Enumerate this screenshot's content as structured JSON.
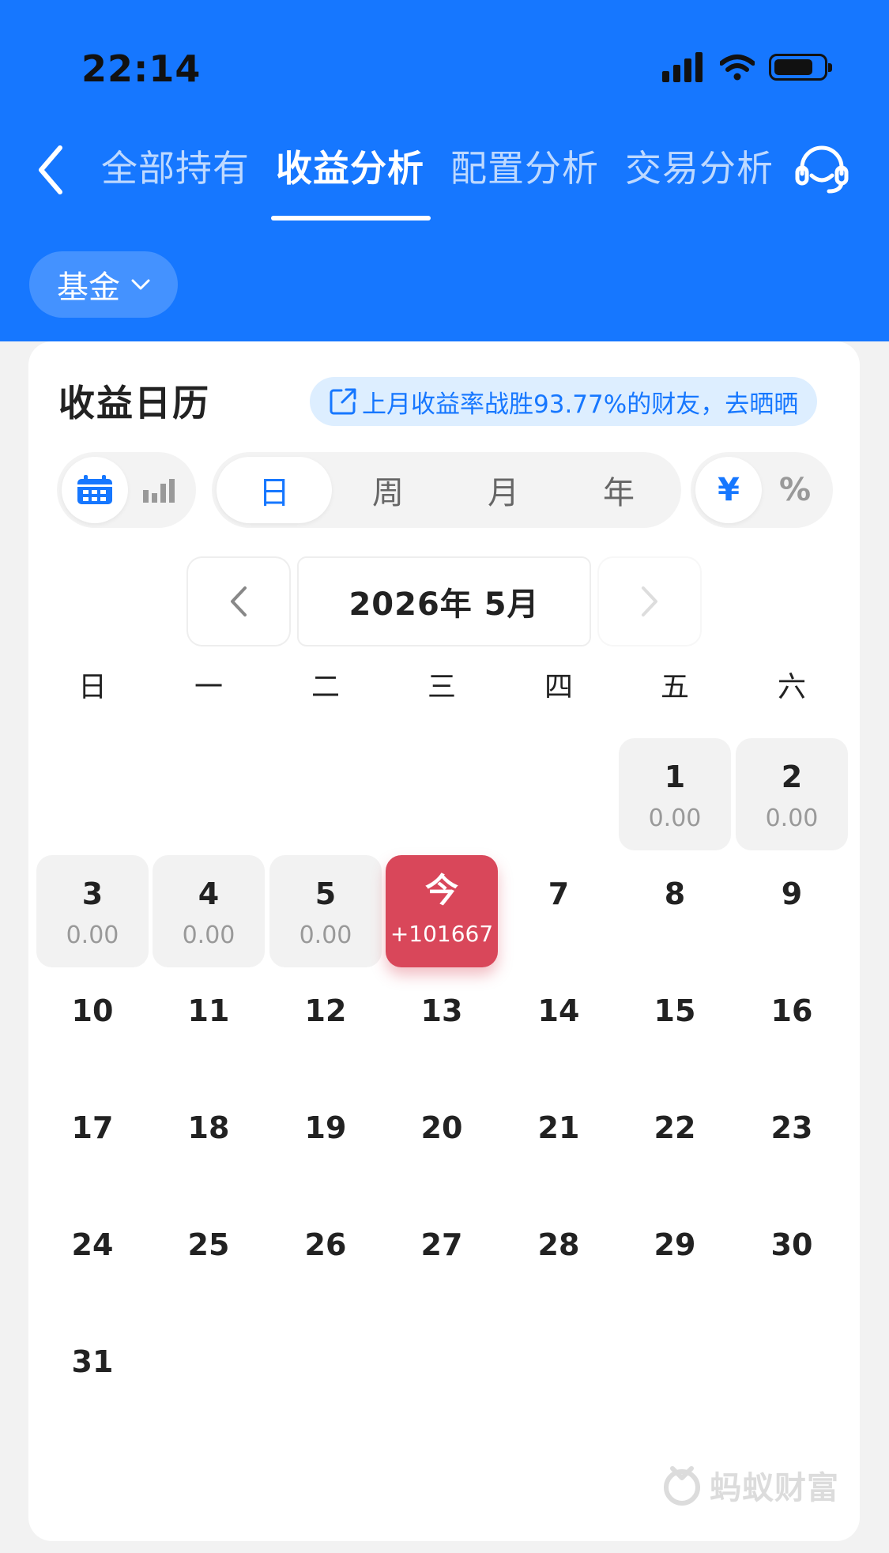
{
  "status_bar": {
    "time": "22:14"
  },
  "nav": {
    "tabs": [
      {
        "label": "全部持有"
      },
      {
        "label": "收益分析"
      },
      {
        "label": "配置分析"
      },
      {
        "label": "交易分析"
      }
    ],
    "active_tab": "收益分析"
  },
  "filter": {
    "label": "基金"
  },
  "card": {
    "title": "收益日历",
    "promo": "上月收益率战胜93.77%的财友，去晒晒",
    "view_toggle": {
      "options": [
        "calendar-icon",
        "bar-chart-icon"
      ],
      "selected": "calendar-icon"
    },
    "period_toggle": {
      "options": [
        "日",
        "周",
        "月",
        "年"
      ],
      "selected": "日"
    },
    "unit_toggle": {
      "options": [
        "¥",
        "%"
      ],
      "selected": "¥"
    }
  },
  "calendar": {
    "month_label": "2026年 5月",
    "weekdays": [
      "日",
      "一",
      "二",
      "三",
      "四",
      "五",
      "六"
    ],
    "today_label": "今",
    "days": [
      {
        "day": "1",
        "value": "0.00"
      },
      {
        "day": "2",
        "value": "0.00"
      },
      {
        "day": "3",
        "value": "0.00"
      },
      {
        "day": "4",
        "value": "0.00"
      },
      {
        "day": "5",
        "value": "0.00"
      },
      {
        "day": "今",
        "value": "+101667",
        "today": true
      },
      {
        "day": "7"
      },
      {
        "day": "8"
      },
      {
        "day": "9"
      },
      {
        "day": "10"
      },
      {
        "day": "11"
      },
      {
        "day": "12"
      },
      {
        "day": "13"
      },
      {
        "day": "14"
      },
      {
        "day": "15"
      },
      {
        "day": "16"
      },
      {
        "day": "17"
      },
      {
        "day": "18"
      },
      {
        "day": "19"
      },
      {
        "day": "20"
      },
      {
        "day": "21"
      },
      {
        "day": "22"
      },
      {
        "day": "23"
      },
      {
        "day": "24"
      },
      {
        "day": "25"
      },
      {
        "day": "26"
      },
      {
        "day": "27"
      },
      {
        "day": "28"
      },
      {
        "day": "29"
      },
      {
        "day": "30"
      },
      {
        "day": "31"
      }
    ],
    "first_weekday_index": 5
  },
  "watermark": {
    "text": "蚂蚁财富"
  },
  "colors": {
    "primary": "#1677ff",
    "today": "#d9475a",
    "header_bg": "#1677ff"
  }
}
